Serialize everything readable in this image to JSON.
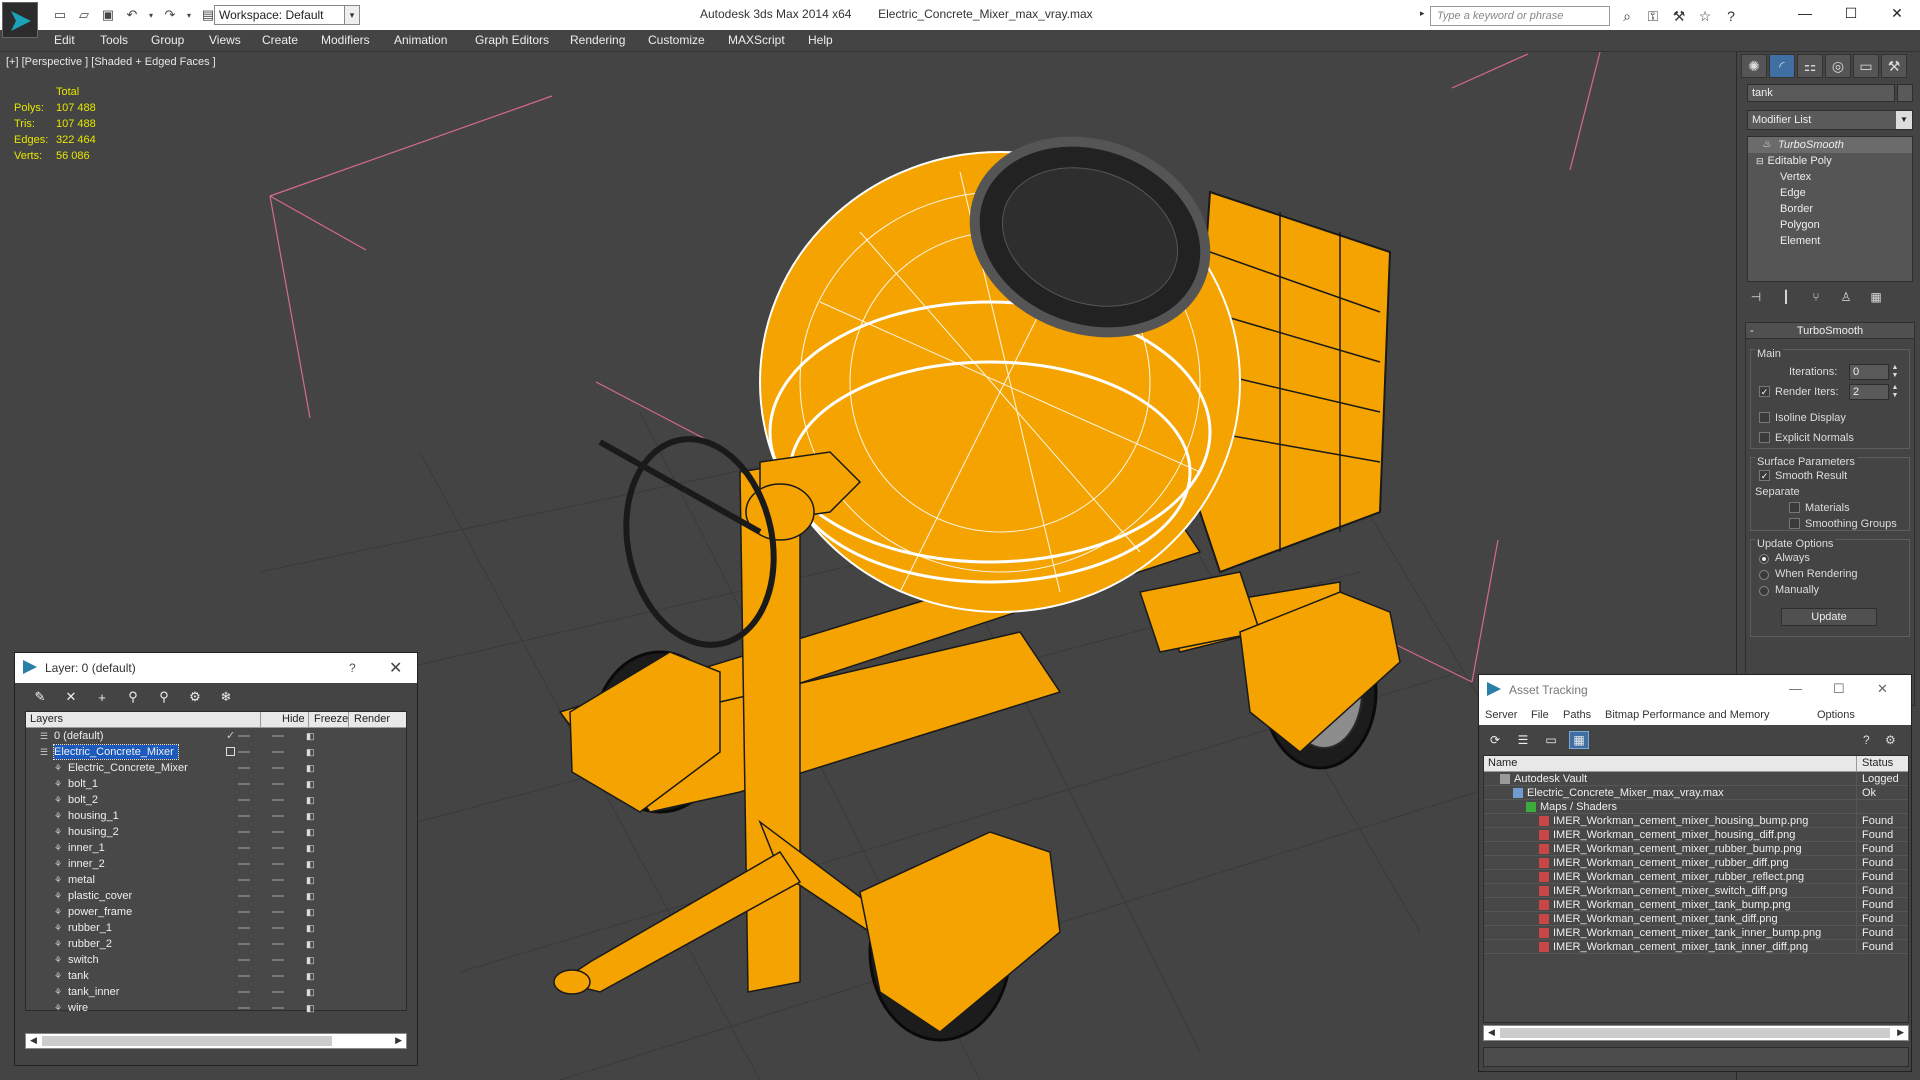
{
  "titlebar": {
    "app_name": "Autodesk 3ds Max  2014 x64",
    "file_name": "Electric_Concrete_Mixer_max_vray.max",
    "workspace": "Workspace: Default",
    "search_placeholder": "Type a keyword or phrase",
    "win_minimize": "—",
    "win_maximize": "☐",
    "win_close": "✕"
  },
  "menu": [
    "Edit",
    "Tools",
    "Group",
    "Views",
    "Create",
    "Modifiers",
    "Animation",
    "Graph Editors",
    "Rendering",
    "Customize",
    "MAXScript",
    "Help"
  ],
  "viewport": {
    "label": "[+] [Perspective ] [Shaded + Edged Faces ]",
    "stats": {
      "header": "Total",
      "rows": [
        {
          "k": "Polys:",
          "v": "107 488"
        },
        {
          "k": "Tris:",
          "v": "107 488"
        },
        {
          "k": "Edges:",
          "v": "322 464"
        },
        {
          "k": "Verts:",
          "v": "56 086"
        }
      ]
    },
    "colors": {
      "background": "#444444",
      "mixer": "#f5a300",
      "wire": "#1a1a1a",
      "grid": "#333333",
      "guide": "#d66a8a"
    }
  },
  "command_panel": {
    "object_name": "tank",
    "modifier_list": "Modifier List",
    "stack": {
      "top": "TurboSmooth",
      "base": "Editable Poly",
      "subs": [
        "Vertex",
        "Edge",
        "Border",
        "Polygon",
        "Element"
      ]
    },
    "rollout": {
      "title": "TurboSmooth",
      "main_group": "Main",
      "iterations_label": "Iterations:",
      "iterations_value": "0",
      "render_iters_label": "Render Iters:",
      "render_iters_value": "2",
      "isoline": "Isoline Display",
      "explicit_normals": "Explicit Normals",
      "surface_group": "Surface Parameters",
      "smooth_result": "Smooth Result",
      "separate": "Separate",
      "materials": "Materials",
      "smoothing_groups": "Smoothing Groups",
      "update_group": "Update Options",
      "always": "Always",
      "when_rendering": "When Rendering",
      "manually": "Manually",
      "update_button": "Update"
    }
  },
  "layer_dialog": {
    "title": "Layer: 0 (default)",
    "help": "?",
    "close": "✕",
    "columns": {
      "layers": "Layers",
      "hide": "Hide",
      "freeze": "Freeze",
      "render": "Render"
    },
    "rows": [
      {
        "name": "0 (default)",
        "level": 0,
        "kind": "layer"
      },
      {
        "name": "Electric_Concrete_Mixer",
        "level": 0,
        "kind": "layer",
        "selected": true
      },
      {
        "name": "Electric_Concrete_Mixer",
        "level": 1,
        "kind": "object"
      },
      {
        "name": "bolt_1",
        "level": 1,
        "kind": "object"
      },
      {
        "name": "bolt_2",
        "level": 1,
        "kind": "object"
      },
      {
        "name": "housing_1",
        "level": 1,
        "kind": "object"
      },
      {
        "name": "housing_2",
        "level": 1,
        "kind": "object"
      },
      {
        "name": "inner_1",
        "level": 1,
        "kind": "object"
      },
      {
        "name": "inner_2",
        "level": 1,
        "kind": "object"
      },
      {
        "name": "metal",
        "level": 1,
        "kind": "object"
      },
      {
        "name": "plastic_cover",
        "level": 1,
        "kind": "object"
      },
      {
        "name": "power_frame",
        "level": 1,
        "kind": "object"
      },
      {
        "name": "rubber_1",
        "level": 1,
        "kind": "object"
      },
      {
        "name": "rubber_2",
        "level": 1,
        "kind": "object"
      },
      {
        "name": "switch",
        "level": 1,
        "kind": "object"
      },
      {
        "name": "tank",
        "level": 1,
        "kind": "object"
      },
      {
        "name": "tank_inner",
        "level": 1,
        "kind": "object"
      },
      {
        "name": "wire",
        "level": 1,
        "kind": "object"
      }
    ]
  },
  "asset_dialog": {
    "title": "Asset Tracking",
    "menu": [
      "Server",
      "File",
      "Paths",
      "Bitmap Performance and Memory",
      "Options"
    ],
    "columns": {
      "name": "Name",
      "status": "Status"
    },
    "rows": [
      {
        "name": "Autodesk Vault",
        "status": "Logged",
        "indent": 0,
        "icon": "vault"
      },
      {
        "name": "Electric_Concrete_Mixer_max_vray.max",
        "status": "Ok",
        "indent": 1,
        "icon": "file"
      },
      {
        "name": "Maps / Shaders",
        "status": "",
        "indent": 2,
        "icon": "maps"
      },
      {
        "name": "IMER_Workman_cement_mixer_housing_bump.png",
        "status": "Found",
        "indent": 3,
        "icon": "png"
      },
      {
        "name": "IMER_Workman_cement_mixer_housing_diff.png",
        "status": "Found",
        "indent": 3,
        "icon": "png"
      },
      {
        "name": "IMER_Workman_cement_mixer_rubber_bump.png",
        "status": "Found",
        "indent": 3,
        "icon": "png"
      },
      {
        "name": "IMER_Workman_cement_mixer_rubber_diff.png",
        "status": "Found",
        "indent": 3,
        "icon": "png"
      },
      {
        "name": "IMER_Workman_cement_mixer_rubber_reflect.png",
        "status": "Found",
        "indent": 3,
        "icon": "png"
      },
      {
        "name": "IMER_Workman_cement_mixer_switch_diff.png",
        "status": "Found",
        "indent": 3,
        "icon": "png"
      },
      {
        "name": "IMER_Workman_cement_mixer_tank_bump.png",
        "status": "Found",
        "indent": 3,
        "icon": "png"
      },
      {
        "name": "IMER_Workman_cement_mixer_tank_diff.png",
        "status": "Found",
        "indent": 3,
        "icon": "png"
      },
      {
        "name": "IMER_Workman_cement_mixer_tank_inner_bump.png",
        "status": "Found",
        "indent": 3,
        "icon": "png"
      },
      {
        "name": "IMER_Workman_cement_mixer_tank_inner_diff.png",
        "status": "Found",
        "indent": 3,
        "icon": "png"
      }
    ]
  }
}
